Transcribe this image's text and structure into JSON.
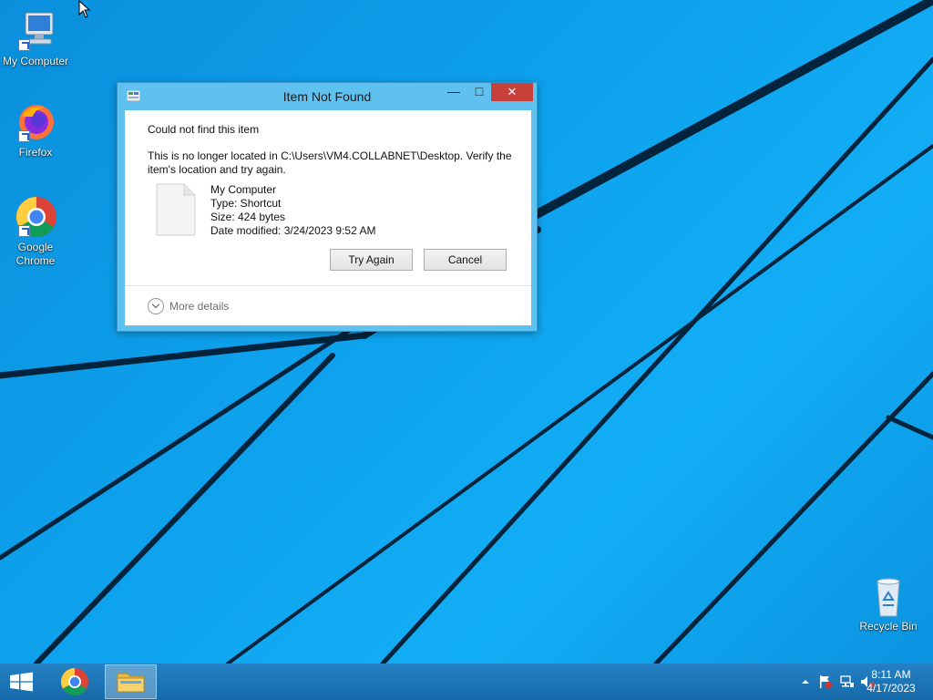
{
  "desktop": {
    "icons": [
      {
        "label": "My Computer",
        "icon": "my-computer-icon"
      },
      {
        "label": "Firefox",
        "icon": "firefox-icon"
      },
      {
        "label": "Google Chrome",
        "icon": "chrome-icon"
      },
      {
        "label": "Recycle Bin",
        "icon": "recycle-bin-icon"
      }
    ],
    "colors": {
      "wallpaper": "#0d9ce8",
      "lines": "#04243d"
    }
  },
  "dialog": {
    "title": "Item Not Found",
    "heading": "Could not find this item",
    "message": "This is no longer located in C:\\Users\\VM4.COLLABNET\\Desktop. Verify the item's location and try again.",
    "file": {
      "name": "My Computer",
      "type": "Type: Shortcut",
      "size": "Size: 424 bytes",
      "modified": "Date modified: 3/24/2023 9:52 AM"
    },
    "buttons": {
      "try_again": "Try Again",
      "cancel": "Cancel"
    },
    "more_details": "More details",
    "controls": {
      "minimize": "—",
      "maximize": "□",
      "close": "✕"
    },
    "colors": {
      "frame": "#5fc1ef",
      "close": "#c7403a"
    }
  },
  "taskbar": {
    "pinned": [
      {
        "name": "Google Chrome",
        "icon": "chrome-icon"
      },
      {
        "name": "File Explorer",
        "icon": "folder-icon",
        "active": true
      }
    ],
    "tray": {
      "icons": [
        "show-hidden-icons-icon",
        "action-center-flag-icon",
        "network-icon",
        "volume-muted-icon"
      ],
      "time": "8:11 AM",
      "date": "4/17/2023"
    },
    "colors": {
      "bar": "#1a74b6"
    }
  }
}
